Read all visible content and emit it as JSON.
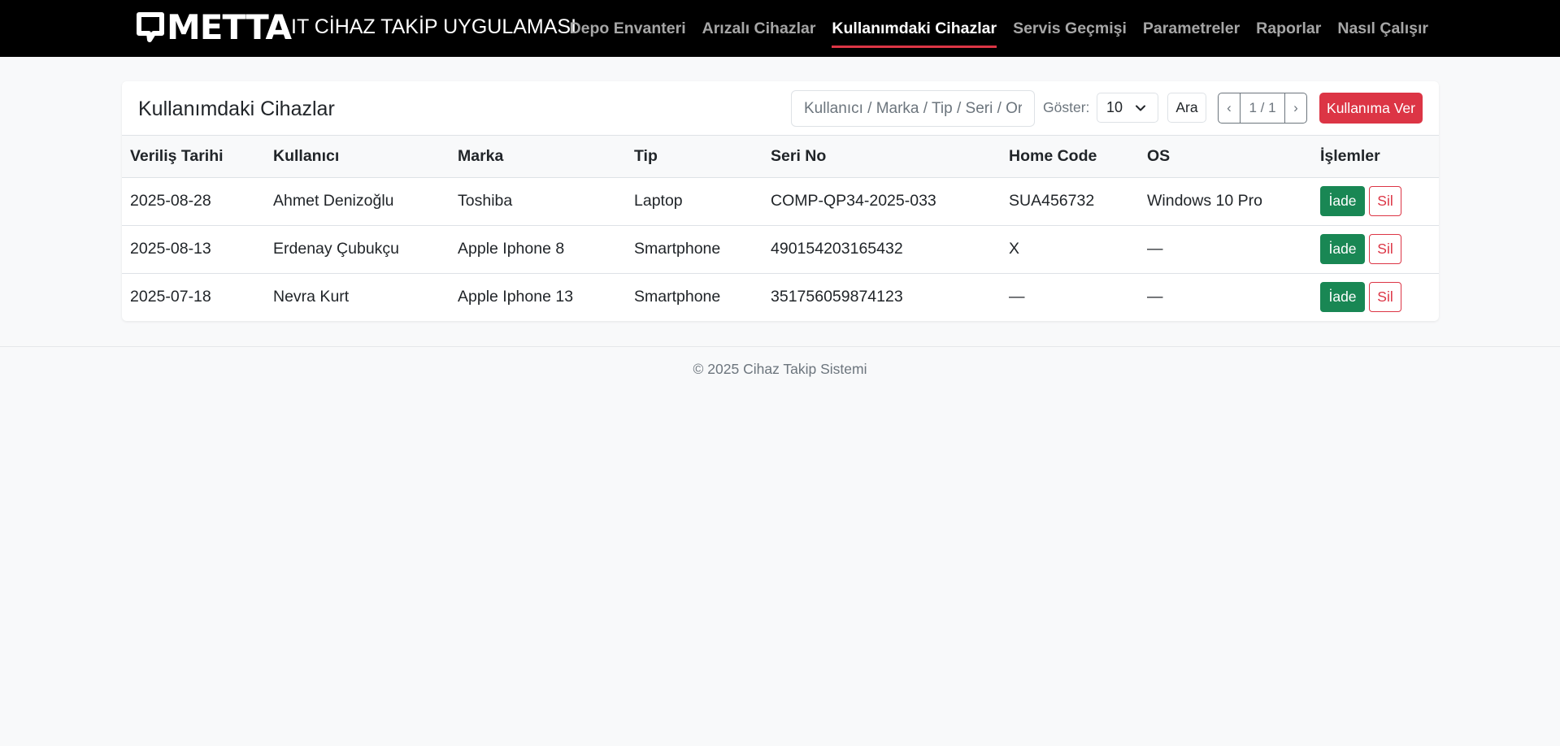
{
  "brand": {
    "logo_text": "METTA",
    "app_title": "IT CİHAZ TAKİP UYGULAMASI"
  },
  "nav": {
    "items": [
      {
        "label": "Depo Envanteri",
        "active": false
      },
      {
        "label": "Arızalı Cihazlar",
        "active": false
      },
      {
        "label": "Kullanımdaki Cihazlar",
        "active": true
      },
      {
        "label": "Servis Geçmişi",
        "active": false
      },
      {
        "label": "Parametreler",
        "active": false
      },
      {
        "label": "Raporlar",
        "active": false
      },
      {
        "label": "Nasıl Çalışır",
        "active": false
      }
    ]
  },
  "main": {
    "title": "Kullanımdaki Cihazlar",
    "search_placeholder": "Kullanıcı / Marka / Tip / Seri / Ortam",
    "show_label": "Göster:",
    "page_size": "10",
    "search_button": "Ara",
    "pagination": {
      "prev": "‹",
      "info": "1 / 1",
      "next": "›"
    },
    "assign_button": "Kullanıma Ver",
    "columns": [
      "Veriliş Tarihi",
      "Kullanıcı",
      "Marka",
      "Tip",
      "Seri No",
      "Home Code",
      "OS",
      "İşlemler"
    ],
    "rows": [
      [
        "2025-08-28",
        "Ahmet Denizoğlu",
        "Toshiba",
        "Laptop",
        "COMP-QP34-2025-033",
        "SUA456732",
        "Windows 10 Pro"
      ],
      [
        "2025-08-13",
        "Erdenay Çubukçu",
        "Apple Iphone 8",
        "Smartphone",
        "490154203165432",
        "X",
        "—"
      ],
      [
        "2025-07-18",
        "Nevra Kurt",
        "Apple Iphone 13",
        "Smartphone",
        "351756059874123",
        "—",
        "—"
      ]
    ],
    "action_labels": {
      "return": "İade",
      "delete": "Sil"
    }
  },
  "footer": {
    "text": "© 2025 Cihaz Takip Sistemi"
  },
  "colors": {
    "accent": "#dc3545",
    "success": "#198754",
    "navbar": "#000000"
  }
}
